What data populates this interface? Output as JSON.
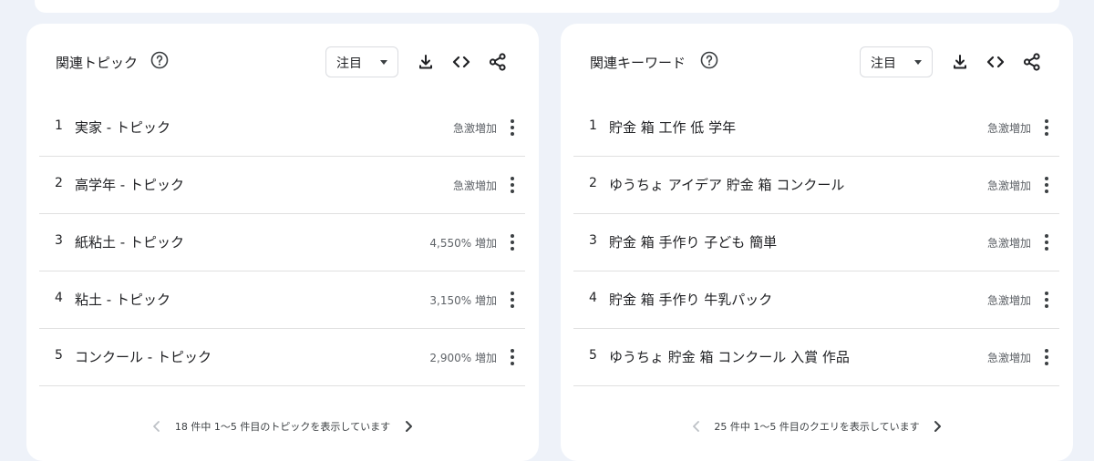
{
  "panels": [
    {
      "title": "関連トピック",
      "sort_label": "注目",
      "items": [
        {
          "rank": "1",
          "term": "実家 - トピック",
          "value": "急激増加"
        },
        {
          "rank": "2",
          "term": "高学年 - トピック",
          "value": "急激増加"
        },
        {
          "rank": "3",
          "term": "紙粘土 - トピック",
          "value": "4,550% 増加"
        },
        {
          "rank": "4",
          "term": "粘土 - トピック",
          "value": "3,150% 増加"
        },
        {
          "rank": "5",
          "term": "コンクール - トピック",
          "value": "2,900% 増加"
        }
      ],
      "pager_text": "18 件中 1～5 件目のトピックを表示しています"
    },
    {
      "title": "関連キーワード",
      "sort_label": "注目",
      "items": [
        {
          "rank": "1",
          "term": "貯金 箱 工作 低 学年",
          "value": "急激増加"
        },
        {
          "rank": "2",
          "term": "ゆうちょ アイデア 貯金 箱 コンクール",
          "value": "急激増加"
        },
        {
          "rank": "3",
          "term": "貯金 箱 手作り 子ども 簡単",
          "value": "急激増加"
        },
        {
          "rank": "4",
          "term": "貯金 箱 手作り 牛乳パック",
          "value": "急激増加"
        },
        {
          "rank": "5",
          "term": "ゆうちょ 貯金 箱 コンクール 入賞 作品",
          "value": "急激増加"
        }
      ],
      "pager_text": "25 件中 1～5 件目のクエリを表示しています"
    }
  ],
  "icons": {
    "help": "help-circle-icon",
    "download": "download-icon",
    "embed": "code-icon",
    "share": "share-icon",
    "menu": "more-vert-icon",
    "prev": "chevron-left-icon",
    "next": "chevron-right-icon"
  },
  "colors": {
    "background": "#eef2f9",
    "card": "#ffffff",
    "text": "#202124",
    "secondary_text": "#5f6368",
    "divider": "#e0e0e0"
  }
}
